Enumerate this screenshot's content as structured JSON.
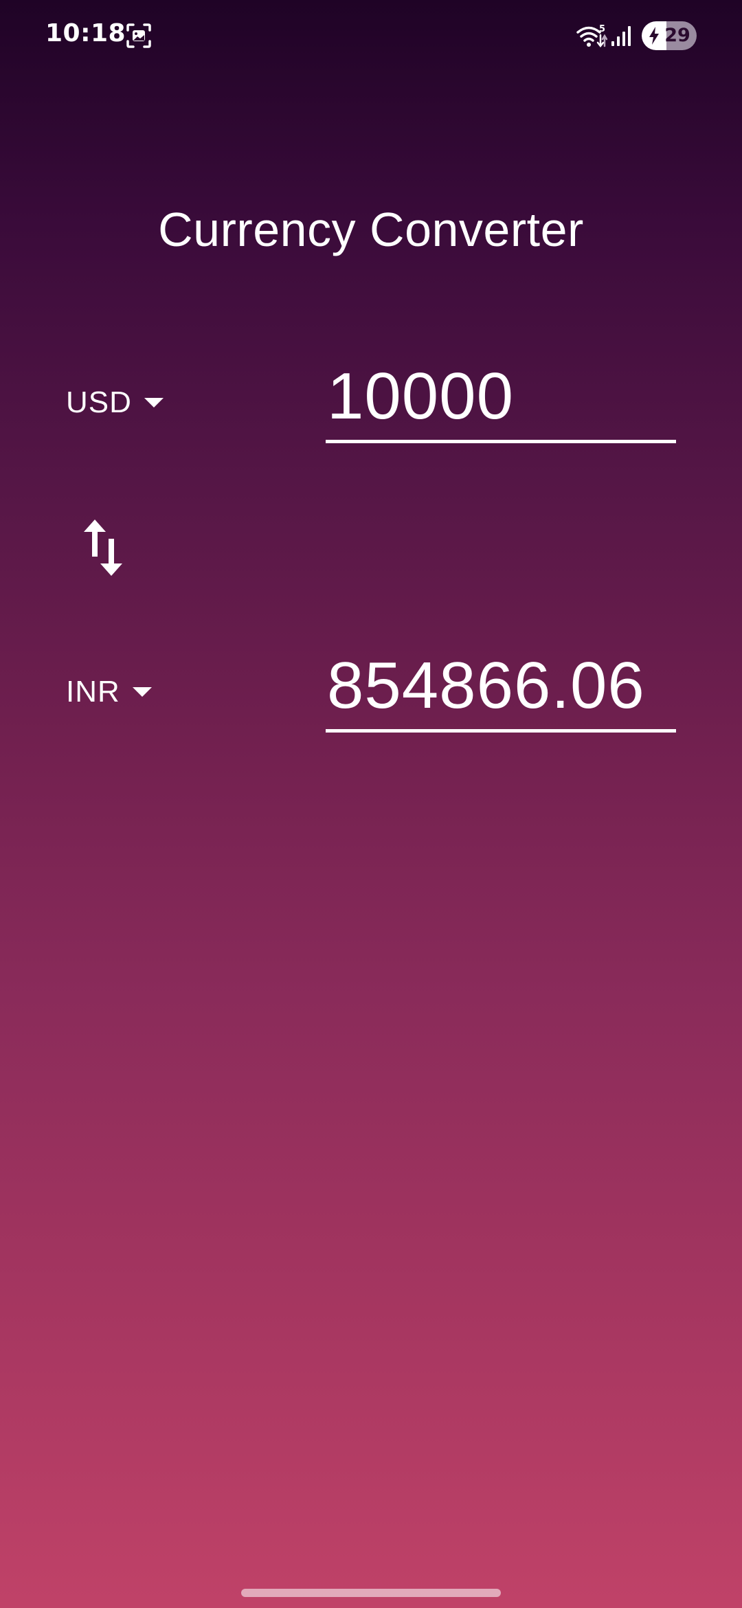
{
  "status_bar": {
    "time": "10:18",
    "battery_level": "29",
    "icons": [
      "screenshot-icon",
      "wifi-icon",
      "signal-icon",
      "battery-charging-icon"
    ],
    "wifi_label": "5"
  },
  "app": {
    "title": "Currency Converter"
  },
  "from": {
    "currency": "USD",
    "amount": "10000"
  },
  "to": {
    "currency": "INR",
    "amount": "854866.06"
  },
  "swap": {
    "icon": "swap-vertical-icon"
  },
  "colors": {
    "gradient_top": "#1f0326",
    "gradient_bottom": "#c04268",
    "text": "#ffffff"
  }
}
